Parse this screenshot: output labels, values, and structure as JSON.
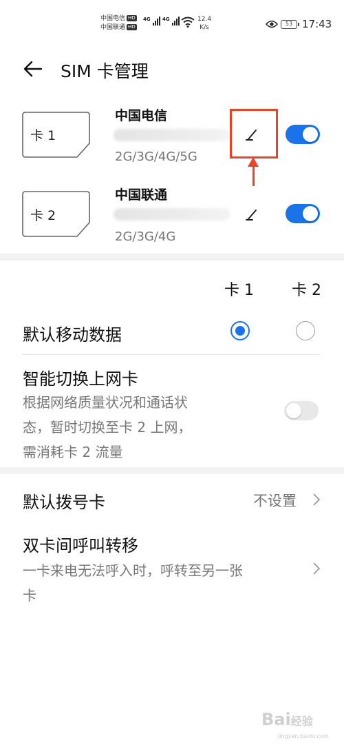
{
  "status_bar": {
    "carrier_1": "中国电信",
    "carrier_2": "中国联通",
    "hd_badge": "HD",
    "network_1": "4G",
    "network_2": "4G",
    "speed_value": "12.4",
    "speed_unit": "K/s",
    "battery": "53",
    "time": "17:43",
    "icons": [
      "signal-icon",
      "wifi-icon",
      "eye-icon",
      "battery-icon"
    ]
  },
  "header": {
    "title": "SIM 卡管理",
    "back_icon": "arrow-left-icon"
  },
  "sims": [
    {
      "card_label": "卡 1",
      "carrier": "中国电信",
      "network_types": "2G/3G/4G/5G",
      "enabled": true,
      "edit_icon": "pencil-icon"
    },
    {
      "card_label": "卡 2",
      "carrier": "中国联通",
      "network_types": "2G/3G/4G",
      "enabled": true,
      "edit_icon": "pencil-icon"
    }
  ],
  "columns": {
    "card1": "卡 1",
    "card2": "卡 2"
  },
  "default_data": {
    "title": "默认移动数据",
    "selected": "card1"
  },
  "smart_switch": {
    "title": "智能切换上网卡",
    "description_lines": [
      "根据网络质量状况和通话状",
      "态，暂时切换至卡 2 上网，",
      "需消耗卡 2 流量"
    ],
    "enabled": false
  },
  "default_dial": {
    "title": "默认拨号卡",
    "value": "不设置"
  },
  "call_forwarding": {
    "title": "双卡间呼叫转移",
    "description_lines": [
      "一卡来电无法呼入时，呼转至另一张",
      "卡"
    ]
  },
  "colors": {
    "accent": "#1a73e8",
    "annotation": "#e8442a"
  },
  "watermark": {
    "text": "经验",
    "brand": "Bai",
    "url": "jingyan.baidu.com"
  }
}
